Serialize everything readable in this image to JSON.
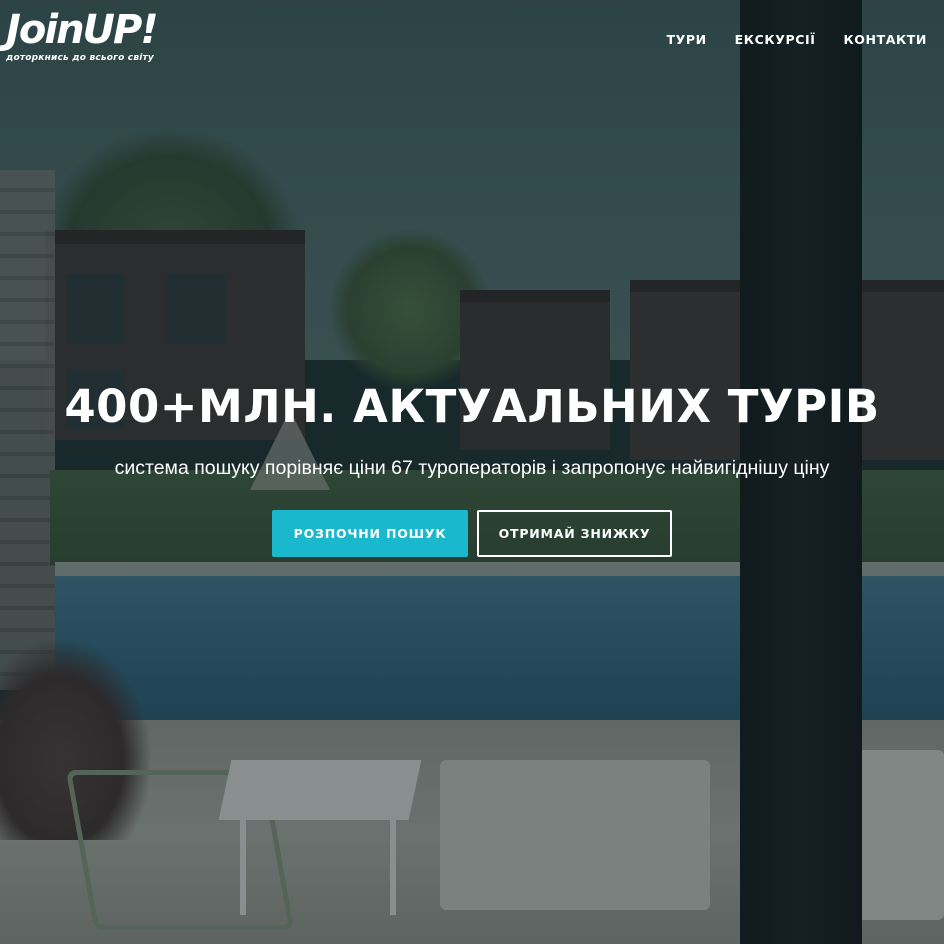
{
  "logo": {
    "wordmark": "JoinUP!",
    "tagline": "доторкнись до всього світу"
  },
  "nav": {
    "items": [
      {
        "label": "ТУРИ"
      },
      {
        "label": "ЕКСКУРСІЇ"
      },
      {
        "label": "КОНТАКТИ"
      }
    ]
  },
  "hero": {
    "title": "400+МЛН. АКТУАЛЬНИХ ТУРІВ",
    "subtitle": "система пошуку порівняє ціни 67 туроператорів і запропонує найвигіднішу ціну",
    "primary_button": "РОЗПОЧНИ ПОШУК",
    "secondary_button": "ОТРИМАЙ ЗНИЖКУ"
  },
  "colors": {
    "accent": "#1ab8cc",
    "text": "#ffffff"
  }
}
